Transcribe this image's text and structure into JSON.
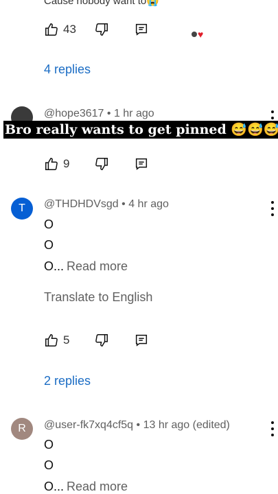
{
  "top": {
    "cut_text": "Cause nobody want to😭",
    "like_count": "43",
    "replies_label": "4 replies"
  },
  "comment1": {
    "handle": "@hope3617",
    "sep": " • ",
    "time": "1 hr ago",
    "like_count": "9"
  },
  "overlay": {
    "text": "Bro really wants to get pinned 😅😅😅"
  },
  "comment2": {
    "avatar_letter": "T",
    "avatar_color": "#065fd4",
    "handle": "@THDHDVsgd",
    "sep": " • ",
    "time": "4 hr ago",
    "lines": [
      "O",
      "O",
      "O..."
    ],
    "read_more": "Read more",
    "translate": "Translate to English",
    "like_count": "5",
    "replies_label": "2 replies"
  },
  "comment3": {
    "avatar_letter": "R",
    "avatar_color": "#a1887f",
    "handle": "@user-fk7xq4cf5q",
    "sep": " • ",
    "time": "13 hr ago (edited)",
    "lines": [
      "O",
      "O",
      "O..."
    ],
    "read_more": "Read more"
  }
}
